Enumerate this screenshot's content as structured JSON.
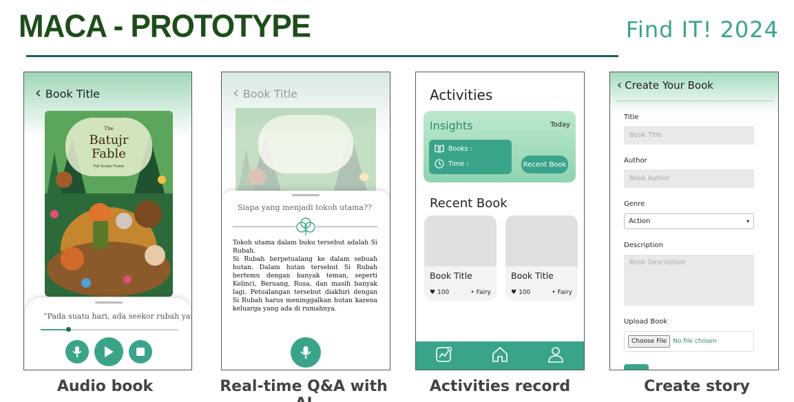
{
  "header": {
    "title": "MACA - PROTOTYPE",
    "event": "Find IT! 2024"
  },
  "colors": {
    "accent": "#3aa48a",
    "title_green": "#1e4d1a",
    "event_teal": "#3aa48a",
    "rule": "#1b5d6a"
  },
  "audio_panel": {
    "back_label": "Book Title",
    "cover": {
      "line1": "The",
      "line2": "Batujr",
      "line3": "Fable",
      "subtitle": "Full Screen Forest"
    },
    "excerpt": "“Pada suatu hari, ada seekor rubah yang",
    "progress": 0.2,
    "controls": [
      "microphone-icon",
      "play-icon",
      "stop-icon"
    ],
    "caption": "Audio book"
  },
  "qa_panel": {
    "back_label": "Book Title",
    "question": "Siapa yang menjadi tokoh utama??",
    "answer": [
      "Tokoh utama dalam buku tersebut adalah Si Rubah.",
      "Si Rubah berpetualang ke dalam sebuah hutan. Dalam hutan tersebut Si Rubah bertemu dengan banyak teman, seperti Kelinci, Beruang, Rusa, dan masih banyak lagi. Petualangan tersebut diakhiri dengan Si Rubah harus meninggalkan hutan karena keluarga yang ada di rumahnya."
    ],
    "caption": "Real-time Q&A with AI"
  },
  "activities_panel": {
    "title": "Activities",
    "insights": {
      "title": "Insights",
      "period": "Today",
      "books_label": "Books :",
      "time_label": "Time :",
      "button": "Recent Book"
    },
    "recent_title": "Recent Book",
    "books": [
      {
        "title": "Book Title",
        "likes": "100",
        "genre": "Fairy"
      },
      {
        "title": "Book Title",
        "likes": "100",
        "genre": "Fairy"
      }
    ],
    "nav": [
      "insights-chart-icon",
      "home-icon",
      "profile-icon"
    ],
    "caption": "Activities record"
  },
  "create_panel": {
    "title": "Create Your Book",
    "fields": {
      "title_label": "Title",
      "title_placeholder": "Book Title",
      "author_label": "Author",
      "author_placeholder": "Book Author",
      "genre_label": "Genre",
      "genre_value": "Action",
      "description_label": "Description",
      "description_placeholder": "Book Description",
      "upload_label": "Upload Book",
      "file_button": "Choose File",
      "file_status": "No file chosen"
    },
    "caption": "Create story"
  }
}
